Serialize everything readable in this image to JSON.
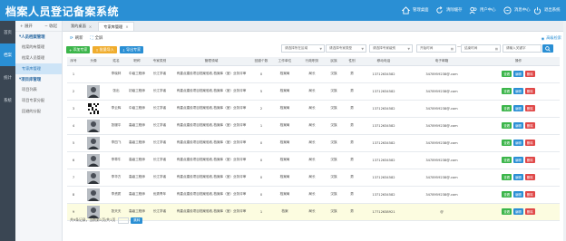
{
  "header": {
    "logo_text": "档案人员登记备案系统",
    "nav": [
      {
        "label": "管理桌面",
        "icon": "home-icon"
      },
      {
        "label": "清除缓存",
        "icon": "refresh-icon"
      },
      {
        "label": "用户中心",
        "icon": "users-icon"
      },
      {
        "label": "消息中心",
        "icon": "message-icon"
      },
      {
        "label": "退出系统",
        "icon": "power-icon"
      }
    ],
    "bar_color": "#2a8fd4"
  },
  "left_strip": {
    "items": [
      "首页",
      "档案",
      "统计",
      "系统"
    ]
  },
  "sidebar": {
    "expand_label": "展开",
    "collapse_label": "收起",
    "sections": [
      {
        "title": "人员档案管理",
        "items": [
          "档案的有管理",
          "档案人员管理",
          "专家库管理"
        ],
        "active_index": 2
      },
      {
        "title": "项目库管理",
        "items": [
          "项目列表",
          "项目专家分配",
          "回避的分配"
        ],
        "active_index": -1
      }
    ]
  },
  "tabs": [
    {
      "label": "我的桌面",
      "active": false
    },
    {
      "label": "专家库管理",
      "active": true
    }
  ],
  "actions": {
    "refresh": "刷新",
    "fullscreen": "全屏",
    "advanced_search": "高级检索"
  },
  "toolbar": {
    "add": "添加专家",
    "import": "批量导入",
    "export": "导出专家",
    "colors": {
      "add": "#3bb54a",
      "import": "#f0ad2e",
      "export": "#2a8fd4"
    }
  },
  "filters": {
    "region": "请选择所在区域",
    "category": "请选择专家类型",
    "level": "请选择专家级别",
    "start_date": "开始时间",
    "separator": "—",
    "end_date": "结束时间",
    "keyword_placeholder": "请输入关键字"
  },
  "table": {
    "columns": [
      "序号",
      "头像",
      "姓名",
      "职称",
      "专家类别",
      "管理领域",
      "回避个数",
      "工作单位",
      "行政职务",
      "民族",
      "性别",
      "移动电话",
      "电子邮箱",
      "操作"
    ],
    "rows": [
      {
        "no": "1",
        "avatar": "none",
        "name": "李晓林",
        "title": "中级工程师",
        "type": "长江学者",
        "domain": "有重点建设项目档案验收,档案库（室）业务评审",
        "count": "0",
        "org": "档案局",
        "duty": "局长",
        "ethnic": "汉族",
        "sex": "男",
        "phone": "13712634582",
        "email": "3478959238@.com",
        "hl": false
      },
      {
        "no": "2",
        "avatar": "portrait",
        "name": "张出",
        "title": "初级工程师",
        "type": "长江学者",
        "domain": "有重点建设项目档案验收,档案库（室）业务评审",
        "count": "5",
        "org": "档案局",
        "duty": "局长",
        "ethnic": "汉族",
        "sex": "男",
        "phone": "13712634582",
        "email": "3478959238@.com",
        "hl": false
      },
      {
        "no": "3",
        "avatar": "qrcode",
        "name": "李云辉",
        "title": "中级工程师",
        "type": "长江学者",
        "domain": "有重点建设项目档案验收,档案库（室）业务评审",
        "count": "2",
        "org": "档案局",
        "duty": "局长",
        "ethnic": "汉族",
        "sex": "男",
        "phone": "13712634582",
        "email": "3478959238@.com",
        "hl": false
      },
      {
        "no": "4",
        "avatar": "portrait",
        "name": "张服平",
        "title": "高级工程师",
        "type": "长江学者",
        "domain": "有重点建设项目档案验收,档案库（室）业务评审",
        "count": "1",
        "org": "档案局",
        "duty": "局长",
        "ethnic": "汉族",
        "sex": "男",
        "phone": "13712634582",
        "email": "3478959238@.com",
        "hl": false
      },
      {
        "no": "5",
        "avatar": "portrait",
        "name": "李四飞",
        "title": "高级工程师",
        "type": "长江学者",
        "domain": "有重点建设项目档案验收,档案库（室）业务评审",
        "count": "0",
        "org": "档案局",
        "duty": "局长",
        "ethnic": "汉族",
        "sex": "男",
        "phone": "13712634582",
        "email": "3478959238@.com",
        "hl": false
      },
      {
        "no": "6",
        "avatar": "portrait",
        "name": "李章牛",
        "title": "高级工程师",
        "type": "长江学者",
        "domain": "有重点建设项目档案验收,档案库（室）业务评审",
        "count": "0",
        "org": "档案局",
        "duty": "局长",
        "ethnic": "汉族",
        "sex": "男",
        "phone": "13712634582",
        "email": "3478959238@.com",
        "hl": false
      },
      {
        "no": "7",
        "avatar": "portrait",
        "name": "李华方",
        "title": "高级工程师",
        "type": "长江学者",
        "domain": "有重点建设项目档案验收,档案库（室）业务评审",
        "count": "0",
        "org": "档案局",
        "duty": "局长",
        "ethnic": "汉族",
        "sex": "男",
        "phone": "13712634582",
        "email": "3478959238@.com",
        "hl": false
      },
      {
        "no": "8",
        "avatar": "portrait",
        "name": "李资质",
        "title": "高级工程师",
        "type": "优秀青年",
        "domain": "有重点建设项目档案验收,档案库（室）业务评审",
        "count": "0",
        "org": "档案局",
        "duty": "局长",
        "ethnic": "汉族",
        "sex": "男",
        "phone": "13712634582",
        "email": "3478959238@.com",
        "hl": false
      },
      {
        "no": "9",
        "avatar": "portrait",
        "name": "张天天",
        "title": "高级工程师",
        "type": "长江学者",
        "domain": "有重点建设项目档案验收,档案库（室）业务评审",
        "count": "1",
        "org": "档案",
        "duty": "局长",
        "ethnic": "汉族",
        "sex": "男",
        "phone": "17712638921",
        "email": "@",
        "hl": true
      }
    ],
    "row_ops": {
      "view": "查看",
      "edit": "编辑",
      "delete": "删除",
      "colors": {
        "view": "#3bb54a",
        "edit": "#2a8fd4",
        "delete": "#e04848"
      }
    }
  },
  "footer": {
    "summary": "共9条记录，当前第1页/共1页",
    "go_label": "跳转"
  }
}
